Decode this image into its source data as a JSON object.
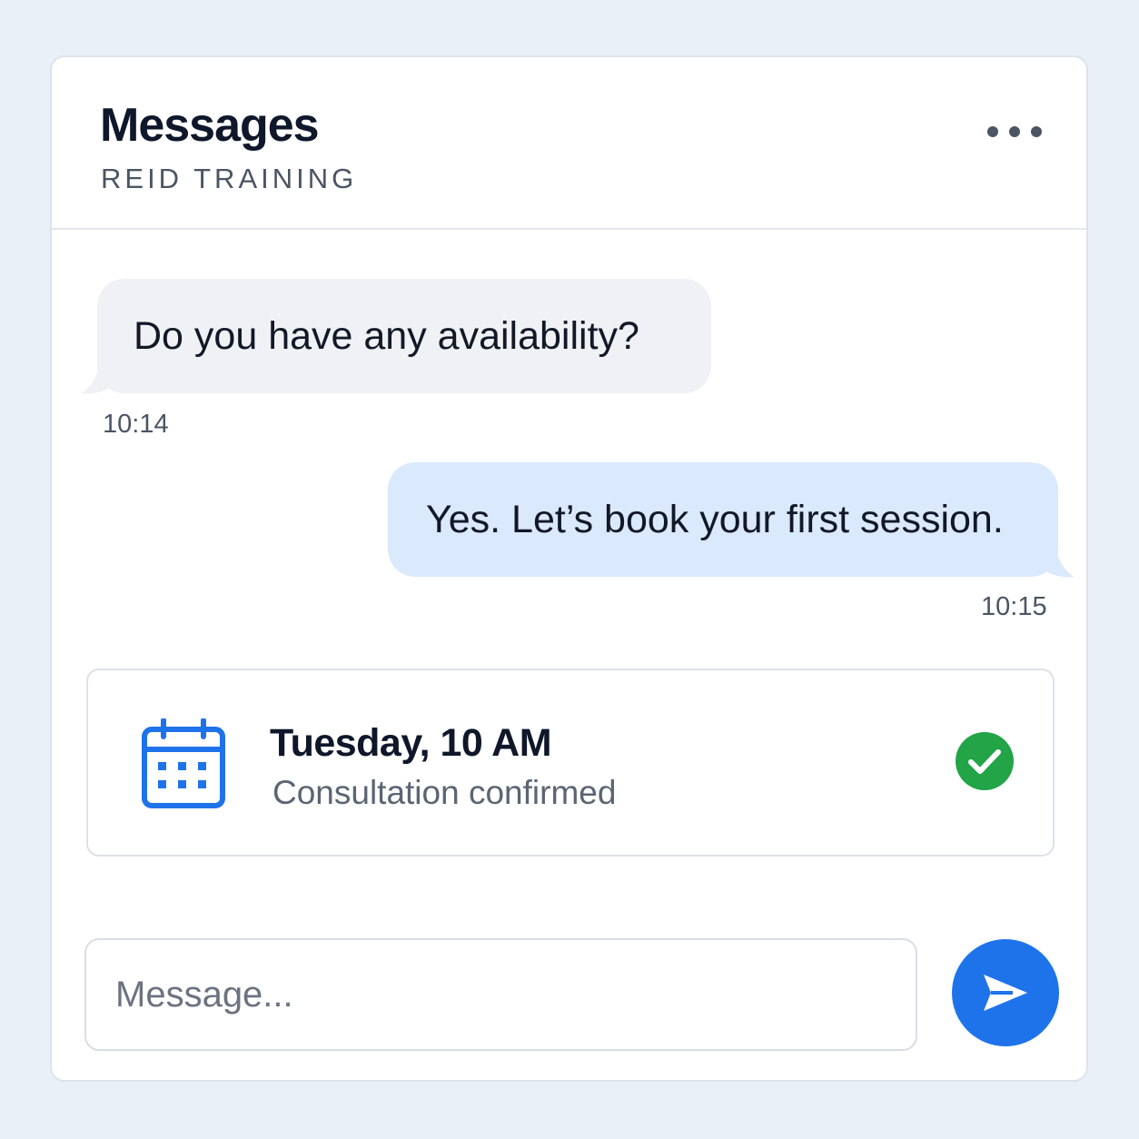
{
  "header": {
    "title": "Messages",
    "subtitle": "REID TRAINING",
    "menu_icon": "more-horizontal-icon"
  },
  "messages": [
    {
      "direction": "incoming",
      "text": "Do you have any availability?",
      "time": "10:14"
    },
    {
      "direction": "outgoing",
      "text": "Yes. Let’s book your first session.",
      "time": "10:15"
    }
  ],
  "booking": {
    "icon": "calendar-icon",
    "title": "Tuesday, 10 AM",
    "status": "Consultation confirmed",
    "status_icon": "check-circle-icon"
  },
  "composer": {
    "placeholder": "Message...",
    "value": "",
    "send_icon": "send-icon"
  },
  "colors": {
    "page_background": "#e9f0f7",
    "incoming_bubble": "#eff1f4",
    "outgoing_bubble": "#dbe9fc",
    "accent_blue": "#1f73ea",
    "success_green": "#22a447"
  }
}
